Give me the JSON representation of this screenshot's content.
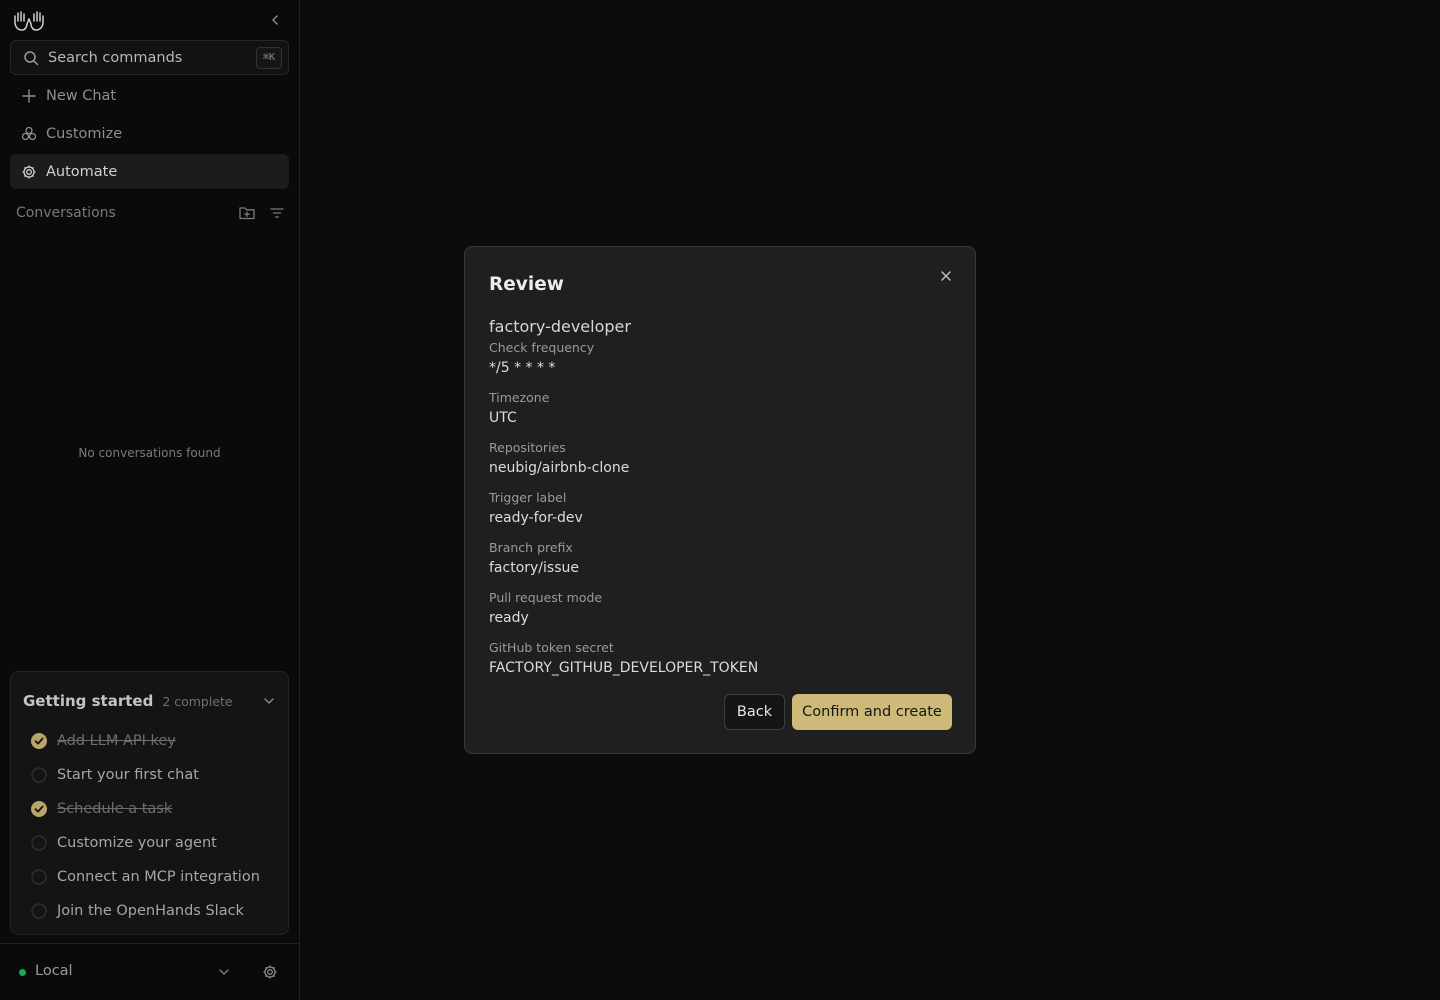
{
  "sidebar": {
    "logo_icon": "openhands-hands-icon",
    "search": {
      "placeholder": "Search commands",
      "shortcut": "⌘K"
    },
    "nav": [
      {
        "label": "New Chat",
        "icon": "plus-icon",
        "active": false
      },
      {
        "label": "Customize",
        "icon": "customize-icon",
        "active": false
      },
      {
        "label": "Automate",
        "icon": "gear-icon",
        "active": true
      }
    ],
    "conversations": {
      "title": "Conversations",
      "empty_text": "No conversations found"
    },
    "getting_started": {
      "title": "Getting started",
      "count": "2 complete",
      "items": [
        {
          "label": "Add LLM API key",
          "done": true
        },
        {
          "label": "Start your first chat",
          "done": false
        },
        {
          "label": "Schedule a task",
          "done": true
        },
        {
          "label": "Customize your agent",
          "done": false
        },
        {
          "label": "Connect an MCP integration",
          "done": false
        },
        {
          "label": "Join the OpenHands Slack",
          "done": false
        }
      ]
    },
    "footer": {
      "environment": "Local",
      "status_color": "#22a35a"
    }
  },
  "modal": {
    "title": "Review",
    "name": "factory-developer",
    "fields": [
      {
        "label": "Check frequency",
        "value": "*/5 * * * *"
      },
      {
        "label": "Timezone",
        "value": "UTC"
      },
      {
        "label": "Repositories",
        "value": "neubig/airbnb-clone"
      },
      {
        "label": "Trigger label",
        "value": "ready-for-dev"
      },
      {
        "label": "Branch prefix",
        "value": "factory/issue"
      },
      {
        "label": "Pull request mode",
        "value": "ready"
      },
      {
        "label": "GitHub token secret",
        "value": "FACTORY_GITHUB_DEVELOPER_TOKEN"
      }
    ],
    "back_label": "Back",
    "confirm_label": "Confirm and create"
  },
  "colors": {
    "accent": "#cdb978",
    "background": "#0b0b0b",
    "modal_background": "#1f1f1f",
    "check_done": "#b8a56a"
  }
}
